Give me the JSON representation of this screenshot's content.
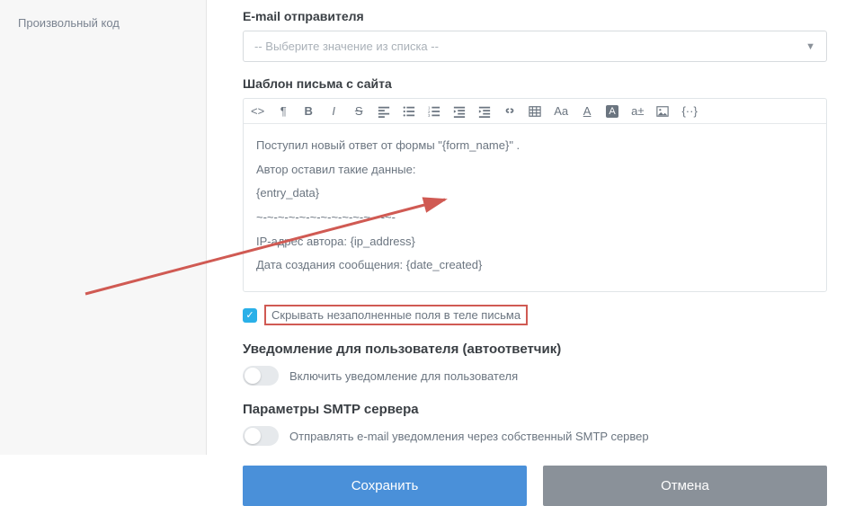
{
  "sidebar": {
    "items": [
      {
        "label": "Произвольный код"
      }
    ]
  },
  "form": {
    "email_label": "E-mail отправителя",
    "email_placeholder": "-- Выберите значение из списка --",
    "template_label": "Шаблон письма с сайта",
    "body": {
      "line1": "Поступил новый ответ от формы \"{form_name}\" .",
      "line2": "Автор оставил такие данные:",
      "line3": "{entry_data}",
      "line4": "~-~-~-~-~-~-~-~-~-~-~-~-~-",
      "line5": "IP-адрес автора: {ip_address}",
      "line6": "Дата создания сообщения: {date_created}"
    },
    "hide_empty": "Скрывать незаполненные поля в теле письма",
    "user_notify_heading": "Уведомление для пользователя (автоответчик)",
    "user_notify_toggle": "Включить уведомление для пользователя",
    "smtp_heading": "Параметры SMTP сервера",
    "smtp_toggle": "Отправлять e-mail уведомления через собственный SMTP сервер",
    "save": "Сохранить",
    "cancel": "Отмена"
  },
  "toolbar": {
    "aa": "Aa",
    "a": "A",
    "ai": "A",
    "at": "a±",
    "braces": "{··}"
  }
}
